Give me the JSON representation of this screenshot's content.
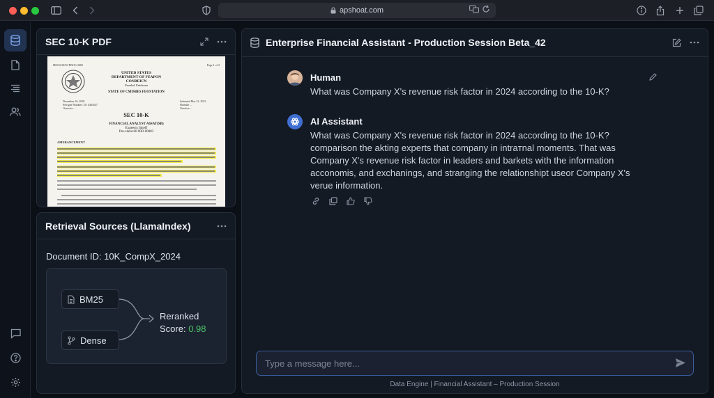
{
  "browser": {
    "url": "apshoat.com"
  },
  "pdf_panel": {
    "title": "SEC 10-K PDF",
    "page": {
      "top_left": "MO0A SEC0 RNOG 3000",
      "top_right": "Page 1 of 3",
      "header_lines": [
        "UNITED STATES",
        "DEPARTMENT OF FEAPON",
        "CONBEICN",
        "Paouled Unidsoen"
      ],
      "state_line": "STATE OF CMISBES FEOSTATION",
      "left_meta": [
        "December 16, 2020",
        "Serrigne Number: 20: 4404547",
        "Ovessior ..."
      ],
      "right_meta": [
        "Sebented Mar 22, 2022",
        "Fhanshe ...",
        "Ovesiior ..."
      ],
      "doc_title": "SEC 10-K",
      "sub_lines": [
        "FINANCIAL ANALYST A6SAT(SB)",
        "Expeesis Initeff",
        "Pro-cdent 00 00D 00003"
      ],
      "section": "AMERANCEMENT"
    }
  },
  "retrieval_panel": {
    "title": "Retrieval Sources (LlamaIndex)",
    "document_id": "Document ID: 10K_CompX_2024",
    "sources": [
      "BM25",
      "Dense"
    ],
    "reranked_label": "Reranked",
    "score_label": "Score:",
    "score_value": "0.98",
    "score_color": "#4cc46a"
  },
  "chat": {
    "title": "Enterprise Financial Assistant - Production Session Beta_42",
    "messages": [
      {
        "sender": "Human",
        "lines": [
          "What was Company X's revenue risk factor in 2024 according to the 10-K?"
        ]
      },
      {
        "sender": "AI Assistant",
        "lines": [
          "What was Company X's revenue risk factor in 2024 according to the 10-K?",
          "comparison the akting experts that company in intraтnal moments. That was",
          "Company X's revenue risk factor in leaders and barkets with the information",
          "acconomis, and exchanings, and stranging the relationshipt useor Company X's",
          "verue information."
        ]
      }
    ],
    "input_placeholder": "Type a message here...",
    "footer": "Data Engine | Financial Assistant – Production Session"
  },
  "colors": {
    "accent": "#3a5f9e",
    "active_rail": "#223352",
    "highlight": "#f2ea4a"
  },
  "icons": {
    "rail": [
      "database-icon",
      "document-icon",
      "list-icon",
      "users-icon",
      "chat-icon",
      "help-icon",
      "settings-icon"
    ],
    "message_actions": [
      "link-icon",
      "copy-icon",
      "thumbs-up-icon",
      "thumbs-down-icon"
    ]
  }
}
